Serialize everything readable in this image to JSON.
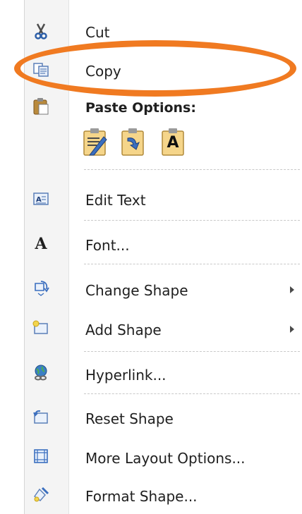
{
  "menu": {
    "items": {
      "cut": {
        "label": "Cut",
        "icon": "scissors-icon"
      },
      "copy": {
        "label": "Copy",
        "icon": "copy-icon"
      },
      "paste_options": {
        "label": "Paste Options:",
        "icon": "clipboard-icon"
      },
      "edit_text": {
        "label": "Edit Text",
        "icon": "edit-text-icon"
      },
      "font": {
        "label": "Font...",
        "icon": "font-icon"
      },
      "change_shape": {
        "label": "Change Shape",
        "icon": "change-shape-icon"
      },
      "add_shape": {
        "label": "Add Shape",
        "icon": "add-shape-icon"
      },
      "hyperlink": {
        "label": "Hyperlink...",
        "icon": "hyperlink-icon"
      },
      "reset_shape": {
        "label": "Reset Shape",
        "icon": "reset-shape-icon"
      },
      "more_layout": {
        "label": "More Layout Options...",
        "icon": "layout-icon"
      },
      "format_shape": {
        "label": "Format Shape...",
        "icon": "format-shape-icon"
      }
    },
    "paste_buttons": [
      {
        "name": "paste-use-destination-theme",
        "glyph": ""
      },
      {
        "name": "paste-keep-source-formatting",
        "glyph": ""
      },
      {
        "name": "paste-keep-text-only",
        "glyph": "A"
      }
    ]
  },
  "colors": {
    "highlight_ellipse": "#f07a21",
    "gutter": "#f4f4f4",
    "text": "#1f1f1f"
  }
}
